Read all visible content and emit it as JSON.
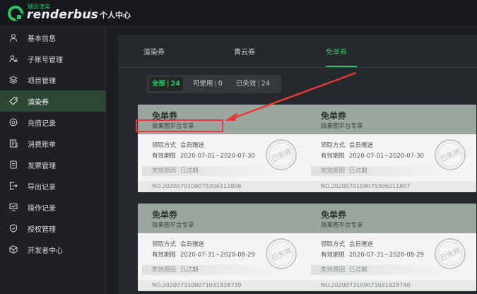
{
  "header": {
    "brand_small": "瑞云渲染",
    "brand": "renderbus",
    "page_title": "个人中心"
  },
  "sidebar": {
    "items": [
      {
        "label": "基本信息",
        "icon": "user-icon"
      },
      {
        "label": "子账号管理",
        "icon": "sub-account-icon"
      },
      {
        "label": "项目管理",
        "icon": "layers-icon"
      },
      {
        "label": "渲染券",
        "icon": "tag-icon",
        "active": true
      },
      {
        "label": "充值记录",
        "icon": "recharge-icon"
      },
      {
        "label": "消费账单",
        "icon": "bill-icon"
      },
      {
        "label": "发票管理",
        "icon": "invoice-icon"
      },
      {
        "label": "导出记录",
        "icon": "export-icon"
      },
      {
        "label": "操作记录",
        "icon": "monitor-icon"
      },
      {
        "label": "授权管理",
        "icon": "shield-icon"
      },
      {
        "label": "开发者中心",
        "icon": "cube-icon"
      }
    ]
  },
  "tabs": [
    {
      "label": "渲染券"
    },
    {
      "label": "青云券"
    },
    {
      "label": "免单券",
      "active": true
    }
  ],
  "filter": {
    "all_label": "全部",
    "all_count": "24",
    "usable_label": "可使用",
    "usable_count": "0",
    "expired_label": "已失效",
    "expired_count": "24"
  },
  "cards": [
    {
      "title": "免单券",
      "subtitle": "效果图平台专享",
      "method_label": "领取方式",
      "method": "会员赠送",
      "validity_label": "有效期限",
      "validity": "2020-07-01~2020-07-30",
      "status_label": "失效原因",
      "status": "已过期",
      "number": "NO.20200701090753061118​06",
      "stamp": "已失效"
    },
    {
      "title": "免单券",
      "subtitle": "效果图平台专享",
      "method_label": "领取方式",
      "method": "会员赠送",
      "validity_label": "有效期限",
      "validity": "2020-07-01~2020-07-30",
      "status_label": "失效原因",
      "status": "已过期",
      "number": "NO.20200701090753062118​07",
      "stamp": "已失效"
    },
    {
      "title": "免单券",
      "subtitle": "效果图平台专享",
      "method_label": "领取方式",
      "method": "会员赠送",
      "validity_label": "有效期限",
      "validity": "2020-07-31~2020-08-29",
      "status_label": "失效原因",
      "status": "已过期",
      "number": "NO.20200731000710318287​39",
      "stamp": "已失效"
    },
    {
      "title": "免单券",
      "subtitle": "效果图平台专享",
      "method_label": "领取方式",
      "method": "会员赠送",
      "validity_label": "有效期限",
      "validity": "2020-07-31~2020-08-29",
      "status_label": "失效原因",
      "status": "已过期",
      "number": "NO.20200731000710319287​40",
      "stamp": "已失效"
    }
  ],
  "colors": {
    "accent": "#2fc26a",
    "annotation": "#e53935"
  }
}
